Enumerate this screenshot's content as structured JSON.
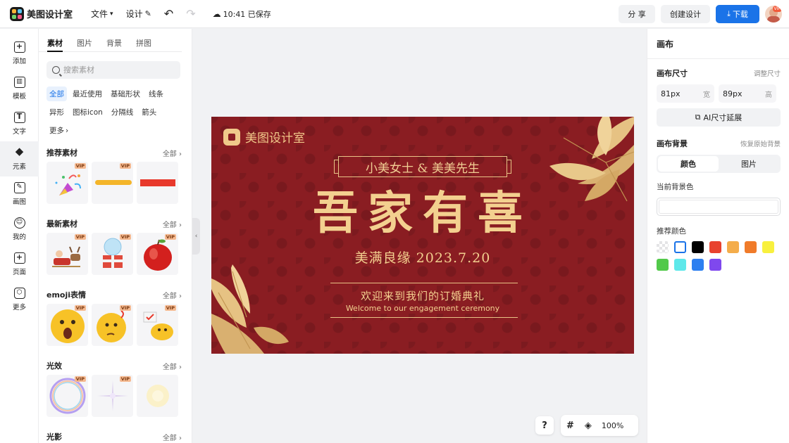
{
  "app": {
    "name": "美图设计室",
    "menu_file": "文件",
    "menu_design": "设计",
    "saved_status": "10:41 已保存",
    "share_label": "分 享",
    "create_label": "创建设计",
    "download_label": "下载",
    "avatar_badge": "VIP"
  },
  "rail": {
    "items": [
      {
        "label": "添加",
        "icon": "plus-icon"
      },
      {
        "label": "模板",
        "icon": "template-icon"
      },
      {
        "label": "文字",
        "icon": "text-icon"
      },
      {
        "label": "元素",
        "icon": "element-icon"
      },
      {
        "label": "画图",
        "icon": "draw-icon"
      },
      {
        "label": "我的",
        "icon": "user-icon"
      },
      {
        "label": "页面",
        "icon": "page-icon"
      },
      {
        "label": "更多",
        "icon": "more-icon"
      }
    ]
  },
  "assets": {
    "tabs": [
      "素材",
      "图片",
      "背景",
      "拼图"
    ],
    "search_placeholder": "搜索素材",
    "filters": [
      "全部",
      "最近使用",
      "基础形状",
      "线条",
      "异形",
      "图标icon",
      "分隔线",
      "箭头",
      "更多"
    ],
    "sections": [
      {
        "title": "推荐素材",
        "more": "全部"
      },
      {
        "title": "最新素材",
        "more": "全部"
      },
      {
        "title": "emoji表情",
        "more": "全部"
      },
      {
        "title": "光效",
        "more": "全部"
      },
      {
        "title": "光影",
        "more": "全部"
      }
    ],
    "vip_label": "VIP"
  },
  "design": {
    "logo_text": "美图设计室",
    "names": "小美女士 & 美美先生",
    "headline": "吾家有喜",
    "date_line": "美满良缘 2023.7.20",
    "welcome_cn": "欢迎来到我们的订婚典礼",
    "welcome_en": "Welcome to our engagement ceremony",
    "bg_color": "#8a1d22",
    "gold_color": "#f0c98a"
  },
  "controls": {
    "help": "?",
    "zoom": "100%"
  },
  "canvas_panel": {
    "title": "画布",
    "size_label": "画布尺寸",
    "resize_link": "调整尺寸",
    "width_value": "81px",
    "width_unit": "宽",
    "height_value": "89px",
    "height_unit": "高",
    "ai_extend": "AI尺寸延展",
    "bg_label": "画布背景",
    "restore_link": "恢复原始背景",
    "seg_color": "颜色",
    "seg_image": "图片",
    "current_bg_label": "当前背景色",
    "recommend_label": "推荐颜色",
    "swatches": [
      "transparent",
      "#ffffff",
      "#000000",
      "#e8422f",
      "#f4ad4b",
      "#f07b2a",
      "#f8f03e",
      "#52c94a",
      "#5ee8ea",
      "#2d7ff0",
      "#7f48ee"
    ]
  }
}
